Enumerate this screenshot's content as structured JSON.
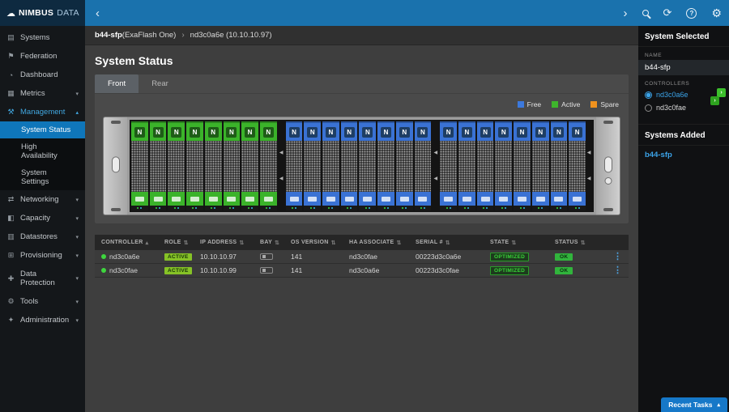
{
  "app": {
    "logo_icon": "☁",
    "logo_primary": "NIMBUS",
    "logo_secondary": "DATA"
  },
  "topbar": {
    "back_icon": "‹",
    "collapse_icon": "›",
    "refresh_icon": "⟳",
    "help_glyph": "?",
    "gear_icon": "⚙"
  },
  "sidebar": {
    "items": [
      {
        "label": "Systems",
        "icon": "▤"
      },
      {
        "label": "Federation",
        "icon": "⚑"
      },
      {
        "label": "Dashboard",
        "icon": "◔"
      },
      {
        "label": "Metrics",
        "icon": "▦",
        "chevron": "▾"
      },
      {
        "label": "Management",
        "icon": "⚒",
        "chevron": "▴",
        "expanded": true
      },
      {
        "label": "System Status",
        "sub": true,
        "active": true
      },
      {
        "label": "High Availability",
        "sub": true
      },
      {
        "label": "System Settings",
        "sub": true
      },
      {
        "label": "Networking",
        "icon": "⇄",
        "chevron": "▾"
      },
      {
        "label": "Capacity",
        "icon": "◧",
        "chevron": "▾"
      },
      {
        "label": "Datastores",
        "icon": "▥",
        "chevron": "▾"
      },
      {
        "label": "Provisioning",
        "icon": "⊞",
        "chevron": "▾"
      },
      {
        "label": "Data Protection",
        "icon": "✚",
        "chevron": "▾"
      },
      {
        "label": "Tools",
        "icon": "⚙",
        "chevron": "▾"
      },
      {
        "label": "Administration",
        "icon": "✦",
        "chevron": "▾"
      }
    ]
  },
  "breadcrumb": {
    "system": "b44-sfp",
    "system_suffix": " (ExaFlash One)",
    "separator": "›",
    "controller": "nd3c0a6e (10.10.10.97)"
  },
  "page": {
    "title": "System Status"
  },
  "tabs": [
    {
      "label": "Front",
      "active": true
    },
    {
      "label": "Rear"
    }
  ],
  "legend": [
    {
      "label": "Free",
      "color": "#3c79dd"
    },
    {
      "label": "Active",
      "color": "#3eb52c"
    },
    {
      "label": "Spare",
      "color": "#f0921e"
    }
  ],
  "enclosure": {
    "drive_letter": "N",
    "arrow": "◀",
    "groups": {
      "g1": [
        {
          "state": "active",
          "color": "#3bb32a"
        },
        {
          "state": "active",
          "color": "#3bb32a"
        },
        {
          "state": "active",
          "color": "#3bb32a"
        },
        {
          "state": "active",
          "color": "#3bb32a"
        },
        {
          "state": "active",
          "color": "#3bb32a"
        },
        {
          "state": "active",
          "color": "#3bb32a"
        },
        {
          "state": "active",
          "color": "#3bb32a"
        },
        {
          "state": "active",
          "color": "#3bb32a"
        }
      ],
      "g2": [
        {
          "state": "free",
          "color": "#3a72d4"
        },
        {
          "state": "free",
          "color": "#3a72d4"
        },
        {
          "state": "free",
          "color": "#3a72d4"
        },
        {
          "state": "free",
          "color": "#3a72d4"
        },
        {
          "state": "free",
          "color": "#3a72d4"
        },
        {
          "state": "free",
          "color": "#3a72d4"
        },
        {
          "state": "free",
          "color": "#3a72d4"
        },
        {
          "state": "free",
          "color": "#3a72d4"
        }
      ],
      "g3": [
        {
          "state": "free",
          "color": "#3a72d4"
        },
        {
          "state": "free",
          "color": "#3a72d4"
        },
        {
          "state": "free",
          "color": "#3a72d4"
        },
        {
          "state": "free",
          "color": "#3a72d4"
        },
        {
          "state": "free",
          "color": "#3a72d4"
        },
        {
          "state": "free",
          "color": "#3a72d4"
        },
        {
          "state": "free",
          "color": "#3a72d4"
        },
        {
          "state": "free",
          "color": "#3a72d4"
        }
      ]
    }
  },
  "table": {
    "menu_icon": "⋮",
    "columns": [
      {
        "label": "CONTROLLER",
        "sort": "▴"
      },
      {
        "label": "ROLE",
        "sort": "⇅"
      },
      {
        "label": "IP ADDRESS",
        "sort": "⇅"
      },
      {
        "label": "BAY",
        "sort": "⇅"
      },
      {
        "label": "OS VERSION",
        "sort": "⇅"
      },
      {
        "label": "HA ASSOCIATE",
        "sort": "⇅"
      },
      {
        "label": "SERIAL #",
        "sort": "⇅"
      },
      {
        "label": "STATE",
        "sort": "⇅"
      },
      {
        "label": "STATUS",
        "sort": "⇅"
      }
    ],
    "rows": [
      {
        "controller": "nd3c0a6e",
        "role": "ACTIVE",
        "ip": "10.10.10.97",
        "os_version": "141",
        "ha_associate": "nd3c0fae",
        "serial": "00223d3c0a6e",
        "state": "OPTIMIZED",
        "status": "OK"
      },
      {
        "controller": "nd3c0fae",
        "role": "ACTIVE",
        "ip": "10.10.10.99",
        "os_version": "141",
        "ha_associate": "nd3c0a6e",
        "serial": "00223d3c0fae",
        "state": "OPTIMIZED",
        "status": "OK"
      }
    ]
  },
  "right_panel": {
    "selected_title": "System Selected",
    "name_label": "NAME",
    "name_value": "b44-sfp",
    "controllers_label": "CONTROLLERS",
    "status_chevron": "›",
    "controllers": [
      {
        "name": "nd3c0a6e",
        "selected": true
      },
      {
        "name": "nd3c0fae",
        "selected": false
      }
    ],
    "added_title": "Systems Added",
    "added_systems": [
      {
        "name": "b44-sfp"
      }
    ]
  },
  "footer": {
    "recent_tasks": "Recent Tasks",
    "chevron": "▴"
  }
}
